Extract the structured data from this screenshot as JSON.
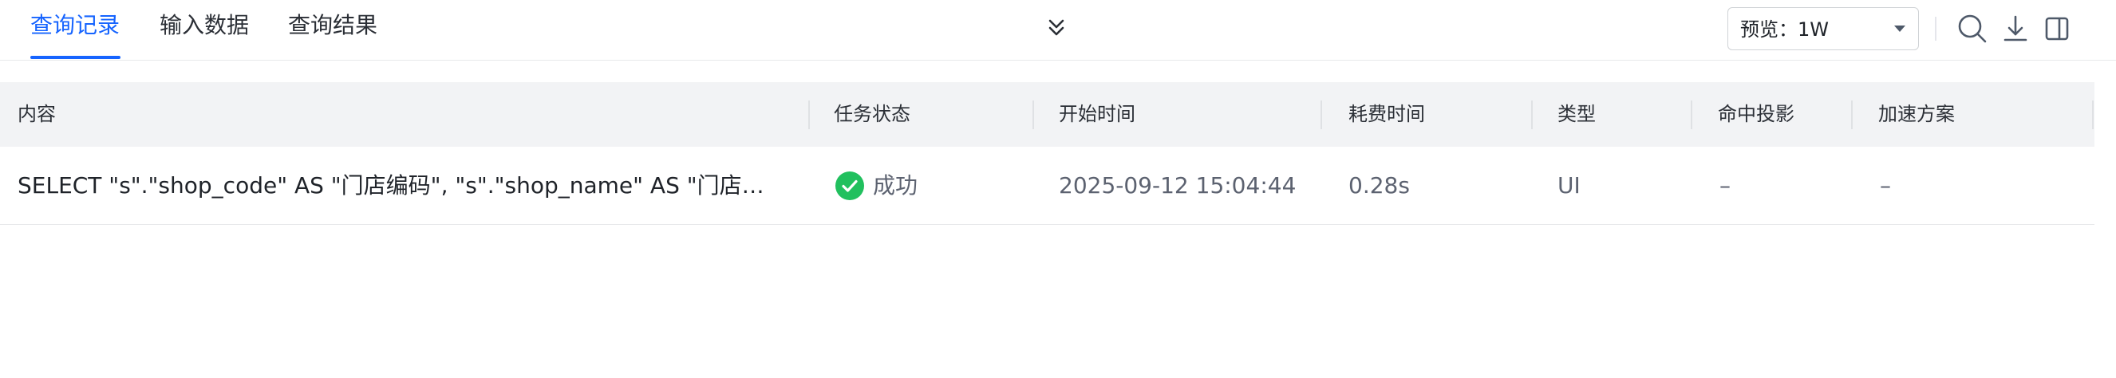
{
  "tabs": [
    {
      "label": "查询记录",
      "active": true
    },
    {
      "label": "输入数据",
      "active": false
    },
    {
      "label": "查询结果",
      "active": false
    }
  ],
  "toolbar": {
    "preview_select_value": "预览：1W",
    "icons": [
      "search-icon",
      "download-icon",
      "panel-toggle-icon"
    ]
  },
  "table": {
    "headers": [
      "内容",
      "任务状态",
      "开始时间",
      "耗费时间",
      "类型",
      "命中投影",
      "加速方案"
    ],
    "rows": [
      {
        "content": "SELECT \"s\".\"shop_code\" AS \"门店编码\", \"s\".\"shop_name\" AS \"门店名称\"",
        "status": "成功",
        "start_time": "2025-09-12 15:04:44",
        "duration": "0.28s",
        "type": "UI",
        "projection": "–",
        "acceleration": "–"
      }
    ]
  },
  "colors": {
    "accent": "#1664ff",
    "success": "#21c05e",
    "header_bg": "#f2f3f5"
  }
}
